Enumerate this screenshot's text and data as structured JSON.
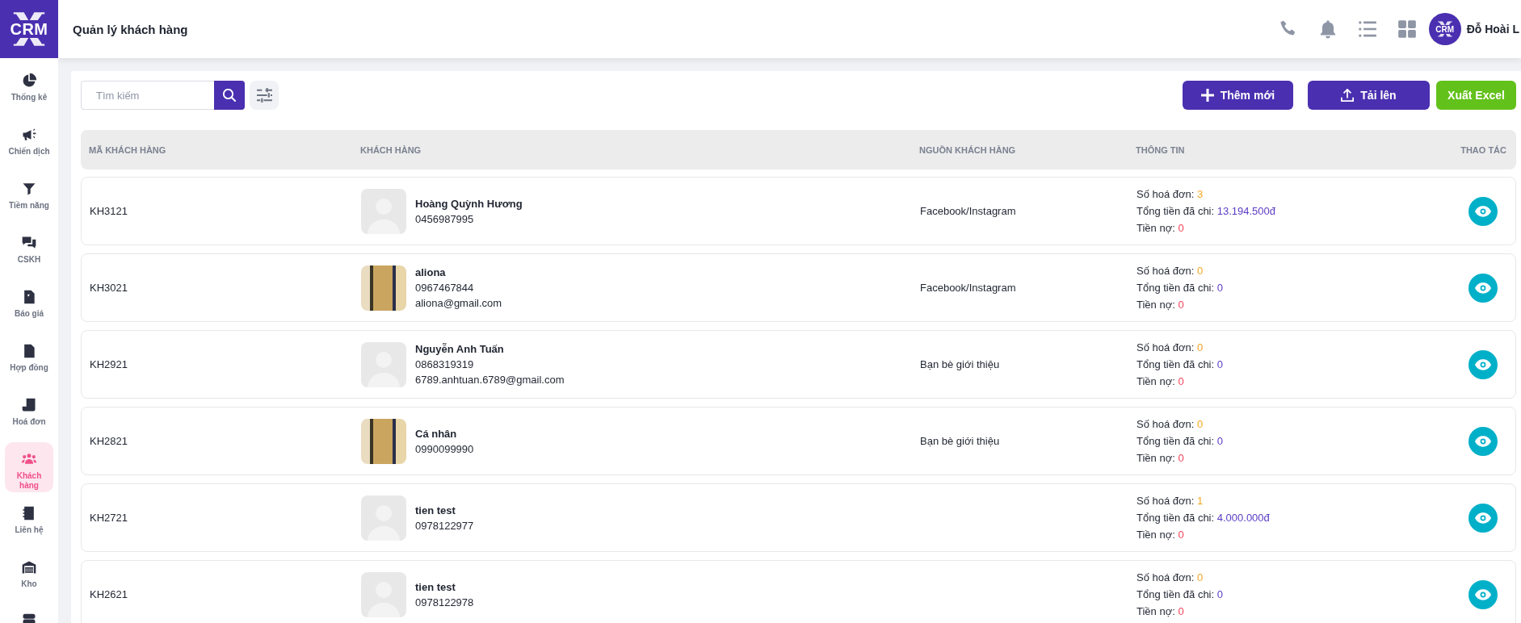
{
  "app": {
    "logo": "CRM",
    "title": "Quản lý khách hàng"
  },
  "header": {
    "avatar_text": "CRM",
    "user_name": "Đỗ Hoài L"
  },
  "sidebar": {
    "items": [
      {
        "label": "Thống kê",
        "selected": false
      },
      {
        "label": "Chiến dịch",
        "selected": false
      },
      {
        "label": "Tiềm năng",
        "selected": false
      },
      {
        "label": "CSKH",
        "selected": false
      },
      {
        "label": "Báo giá",
        "selected": false
      },
      {
        "label": "Hợp đồng",
        "selected": false
      },
      {
        "label": "Hoá đơn",
        "selected": false
      },
      {
        "label": "Khách hàng",
        "selected": true
      },
      {
        "label": "Liên hệ",
        "selected": false
      },
      {
        "label": "Kho",
        "selected": false
      },
      {
        "selected": false
      }
    ]
  },
  "toolbar": {
    "search": {
      "placeholder": "Tìm kiếm"
    },
    "buttons": [
      {
        "label": "Thêm mới",
        "kind": "add"
      },
      {
        "label": "Tải lên",
        "kind": "upload"
      },
      {
        "label": "Xuất Excel",
        "kind": "export"
      }
    ]
  },
  "table": {
    "columns": [
      "MÃ KHÁCH HÀNG",
      "KHÁCH HÀNG",
      "NGUỒN KHÁCH HÀNG",
      "THÔNG TIN",
      "THAO TÁC"
    ],
    "rows": [
      {
        "code": "KH3121",
        "has_photo": false,
        "name": "Hoàng Quỳnh Hương",
        "phone": "0456987995",
        "source": "Facebook/Instagram",
        "invoices_label": "Số hoá đơn:",
        "invoices": "3",
        "spent_label": "Tổng tiền đã chi:",
        "spent": "13.194.500đ",
        "debt_label": "Tiền nợ:",
        "debt": "0"
      },
      {
        "code": "KH3021",
        "has_photo": true,
        "name": "aliona",
        "phone": "0967467844",
        "email": "aliona@gmail.com",
        "source": "Facebook/Instagram",
        "invoices_label": "Số hoá đơn:",
        "invoices": "0",
        "spent_label": "Tổng tiền đã chi:",
        "spent": "0",
        "debt_label": "Tiền nợ:",
        "debt": "0"
      },
      {
        "code": "KH2921",
        "has_photo": false,
        "name": "Nguyễn Anh Tuấn",
        "phone": "0868319319",
        "email": "6789.anhtuan.6789@gmail.com",
        "source": "Bạn bè giới thiệu",
        "invoices_label": "Số hoá đơn:",
        "invoices": "0",
        "spent_label": "Tổng tiền đã chi:",
        "spent": "0",
        "debt_label": "Tiền nợ:",
        "debt": "0"
      },
      {
        "code": "KH2821",
        "has_photo": true,
        "name": "Cá nhân",
        "phone": "0990099990",
        "source": "Bạn bè giới thiệu",
        "invoices_label": "Số hoá đơn:",
        "invoices": "0",
        "spent_label": "Tổng tiền đã chi:",
        "spent": "0",
        "debt_label": "Tiền nợ:",
        "debt": "0"
      },
      {
        "code": "KH2721",
        "has_photo": false,
        "name": "tien test",
        "phone": "0978122977",
        "invoices_label": "Số hoá đơn:",
        "invoices": "1",
        "spent_label": "Tổng tiền đã chi:",
        "spent": "4.000.000đ",
        "debt_label": "Tiền nợ:",
        "debt": "0"
      },
      {
        "code": "KH2621",
        "has_photo": false,
        "name": "tien test",
        "phone": "0978122978",
        "invoices_label": "Số hoá đơn:",
        "invoices": "0",
        "spent_label": "Tổng tiền đã chi:",
        "spent": "0",
        "debt_label": "Tiền nợ:",
        "debt": "0"
      }
    ]
  }
}
